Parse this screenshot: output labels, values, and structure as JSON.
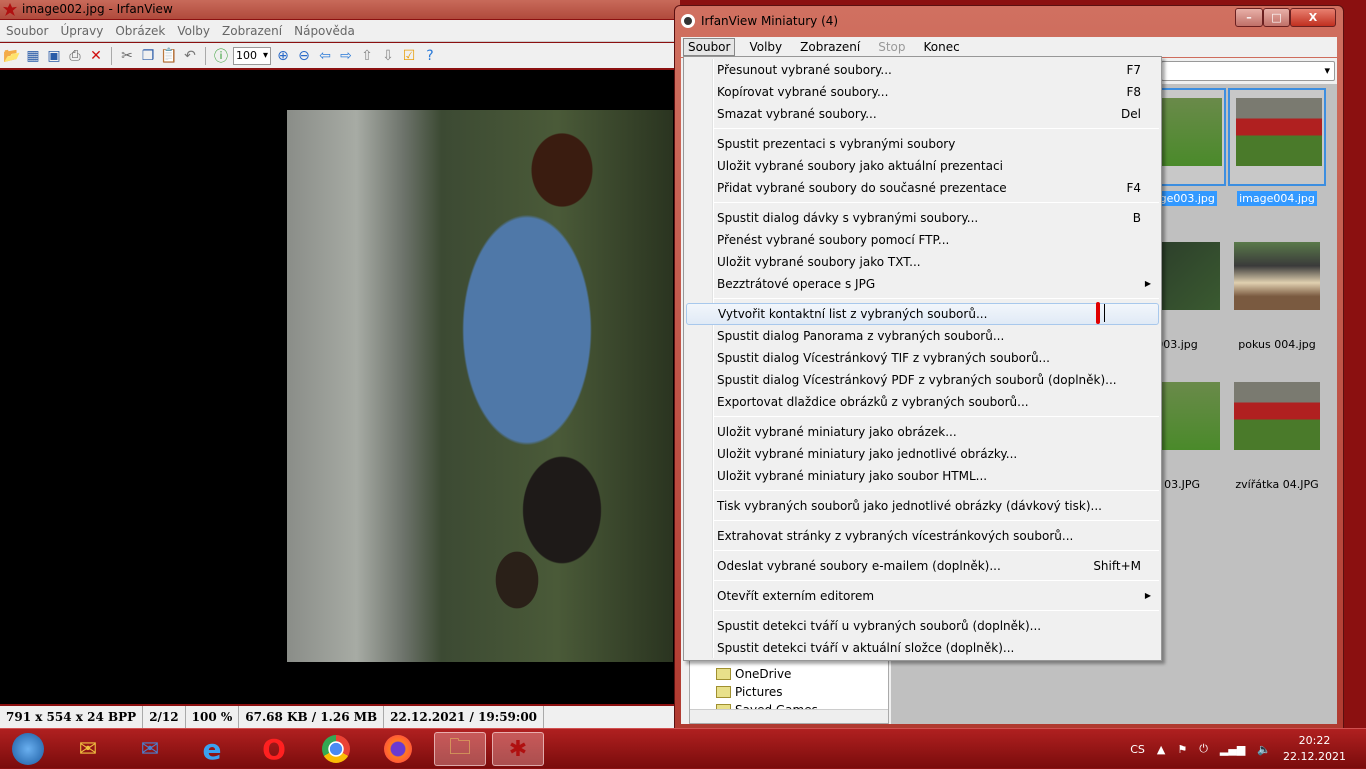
{
  "main_window": {
    "title": "image002.jpg - IrfanView",
    "menu": [
      "Soubor",
      "Úpravy",
      "Obrázek",
      "Volby",
      "Zobrazení",
      "Nápověda"
    ],
    "zoom_value": "100",
    "status": [
      "791 x 554 x 24 BPP",
      "2/12",
      "100 %",
      "67.68 KB / 1.26 MB",
      "22.12.2021 / 19:59:00"
    ]
  },
  "thumbs_window": {
    "title": "IrfanView Miniatury (4)",
    "menu": [
      "Soubor",
      "Volby",
      "Zobrazení",
      "Stop",
      "Konec"
    ],
    "tree": [
      "OneDrive",
      "Pictures",
      "Saved Games"
    ],
    "thumbnails": [
      {
        "label": "image003.jpg",
        "visible_label": "003.jpg",
        "selected": true
      },
      {
        "label": "image004.jpg",
        "visible_label": "image004.jpg",
        "selected": true
      },
      {
        "label": "003.jpg",
        "visible_label": "003.jpg",
        "selected": false
      },
      {
        "label": "pokus 004.jpg",
        "visible_label": "pokus 004.jpg",
        "selected": false
      },
      {
        "label": "a 03.JPG",
        "visible_label": "a 03.JPG",
        "selected": false
      },
      {
        "label": "zvířátka 04.JPG",
        "visible_label": "zvířátka 04.JPG",
        "selected": false
      }
    ]
  },
  "popup_menu": {
    "groups": [
      [
        {
          "label": "Přesunout vybrané soubory...",
          "shortcut": "F7"
        },
        {
          "label": "Kopírovat vybrané soubory...",
          "shortcut": "F8"
        },
        {
          "label": "Smazat vybrané soubory...",
          "shortcut": "Del"
        }
      ],
      [
        {
          "label": "Spustit prezentaci s vybranými soubory"
        },
        {
          "label": "Uložit vybrané soubory jako aktuální prezentaci"
        },
        {
          "label": "Přidat vybrané soubory do současné prezentace",
          "shortcut": "F4"
        }
      ],
      [
        {
          "label": "Spustit dialog dávky s vybranými soubory...",
          "shortcut": "B"
        },
        {
          "label": "Přenést vybrané soubory pomocí FTP..."
        },
        {
          "label": "Uložit vybrané soubory jako TXT..."
        },
        {
          "label": "Bezztrátové operace s JPG",
          "submenu": true
        }
      ],
      [
        {
          "label": "Vytvořit kontaktní list z vybraných souborů...",
          "highlighted": true
        },
        {
          "label": "Spustit dialog Panorama z vybraných souborů..."
        },
        {
          "label": "Spustit dialog Vícestránkový TIF z vybraných souborů..."
        },
        {
          "label": "Spustit dialog Vícestránkový PDF z vybraných souborů (doplněk)..."
        },
        {
          "label": "Exportovat dlaždice obrázků z vybraných souborů..."
        }
      ],
      [
        {
          "label": "Uložit vybrané miniatury jako obrázek..."
        },
        {
          "label": "Uložit vybrané miniatury jako jednotlivé obrázky..."
        },
        {
          "label": "Uložit vybrané miniatury jako soubor HTML..."
        }
      ],
      [
        {
          "label": "Tisk vybraných souborů jako jednotlivé obrázky (dávkový tisk)..."
        }
      ],
      [
        {
          "label": "Extrahovat stránky z vybraných vícestránkových souborů..."
        }
      ],
      [
        {
          "label": "Odeslat vybrané soubory e-mailem (doplněk)...",
          "shortcut": "Shift+M"
        }
      ],
      [
        {
          "label": "Otevřít externím editorem",
          "submenu": true
        }
      ],
      [
        {
          "label": "Spustit detekci tváří u vybraných souborů (doplněk)..."
        },
        {
          "label": "Spustit detekci tváří v aktuální složce (doplněk)..."
        }
      ]
    ]
  },
  "taskbar": {
    "apps": [
      "start-orb",
      "outlook",
      "thunderbird",
      "internet-explorer",
      "opera",
      "chrome",
      "firefox",
      "file-explorer",
      "irfanview"
    ],
    "language": "CS",
    "time": "20:22",
    "date": "22.12.2021"
  },
  "colors": {
    "selection": "#3399ff",
    "theme": "#8b1010",
    "highlight_mark": "#e00000"
  }
}
